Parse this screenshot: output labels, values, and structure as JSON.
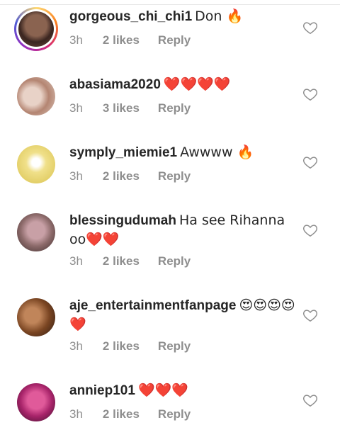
{
  "comments": [
    {
      "username": "gorgeous_chi_chi1",
      "text": "Don 🔥",
      "time": "3h",
      "likes": "2 likes",
      "reply": "Reply",
      "avatar_color": "#6b4a3a",
      "story_ring": true
    },
    {
      "username": "abasiama2020",
      "text": "❤️❤️❤️❤️",
      "time": "3h",
      "likes": "3 likes",
      "reply": "Reply",
      "avatar_color": "#c9a08a",
      "story_ring": false
    },
    {
      "username": "symply_miemie1",
      "text": "Awwww 🔥",
      "time": "3h",
      "likes": "2 likes",
      "reply": "Reply",
      "avatar_color": "#e8d36a",
      "story_ring": false
    },
    {
      "username": "blessingudumah",
      "text": "Ha see Rihanna oo❤️❤️",
      "time": "3h",
      "likes": "2 likes",
      "reply": "Reply",
      "avatar_color": "#7a5c57",
      "story_ring": false
    },
    {
      "username": "aje_entertainmentfanpage",
      "text": "😍😍😍😍❤️",
      "time": "3h",
      "likes": "2 likes",
      "reply": "Reply",
      "avatar_color": "#9a5a2e",
      "story_ring": false
    },
    {
      "username": "anniep101",
      "text": "❤️❤️❤️",
      "time": "3h",
      "likes": "2 likes",
      "reply": "Reply",
      "avatar_color": "#b0306e",
      "story_ring": false
    }
  ]
}
